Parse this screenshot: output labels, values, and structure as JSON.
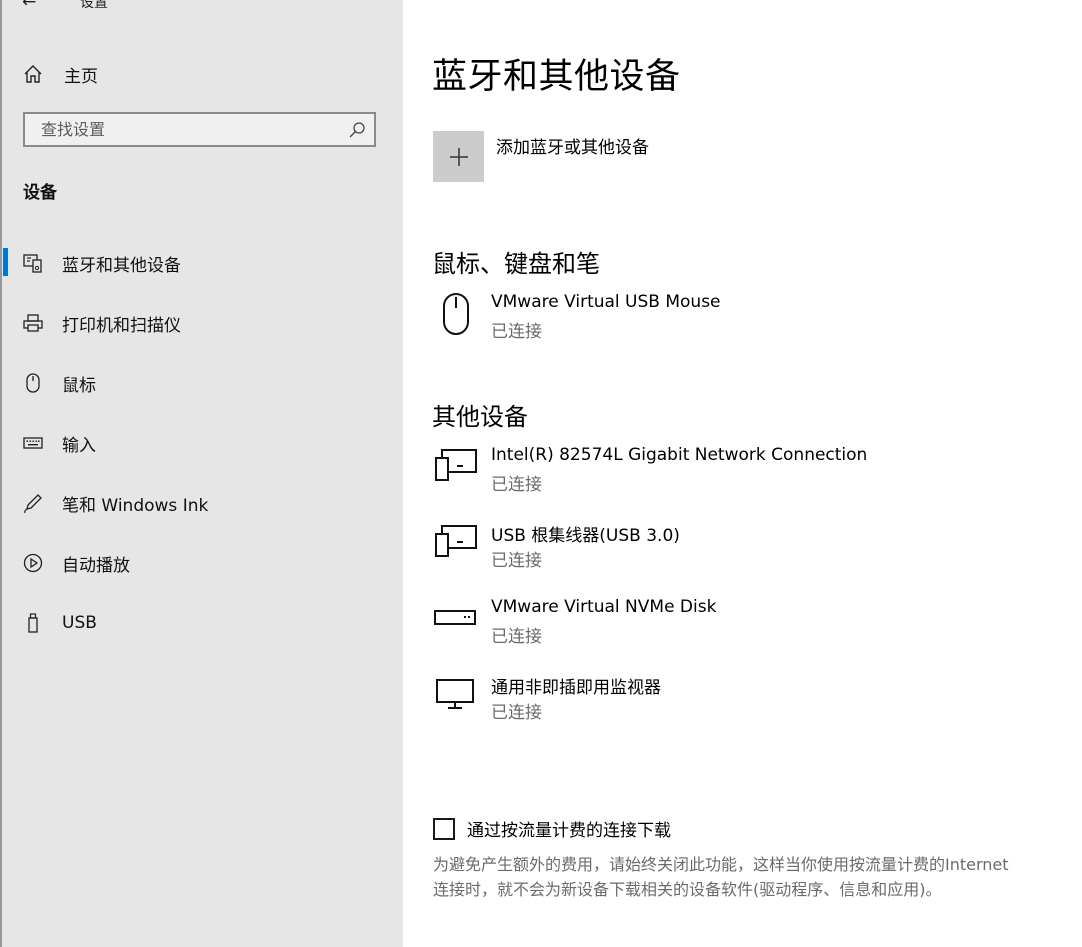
{
  "window": {
    "back_glyph": "←",
    "title": "设置"
  },
  "sidebar": {
    "home_label": "主页",
    "search_placeholder": "查找设置",
    "section_heading": "设备",
    "items": [
      {
        "label": "蓝牙和其他设备",
        "icon": "bluetooth-devices-icon",
        "selected": true
      },
      {
        "label": "打印机和扫描仪",
        "icon": "printer-icon",
        "selected": false
      },
      {
        "label": "鼠标",
        "icon": "mouse-icon",
        "selected": false
      },
      {
        "label": "输入",
        "icon": "keyboard-icon",
        "selected": false
      },
      {
        "label": "笔和 Windows Ink",
        "icon": "pen-icon",
        "selected": false
      },
      {
        "label": "自动播放",
        "icon": "autoplay-icon",
        "selected": false
      },
      {
        "label": "USB",
        "icon": "usb-icon",
        "selected": false
      }
    ],
    "accent_color": "#0078d7"
  },
  "main": {
    "title": "蓝牙和其他设备",
    "add_device_label": "添加蓝牙或其他设备",
    "groups": [
      {
        "title": "鼠标、键盘和笔",
        "devices": [
          {
            "name": "VMware Virtual USB Mouse",
            "status": "已连接",
            "icon": "mouse-icon"
          }
        ]
      },
      {
        "title": "其他设备",
        "devices": [
          {
            "name": "Intel(R) 82574L Gigabit Network Connection",
            "status": "已连接",
            "icon": "device-generic-icon"
          },
          {
            "name": "USB 根集线器(USB 3.0)",
            "status": "已连接",
            "icon": "device-generic-icon"
          },
          {
            "name": "VMware Virtual NVMe Disk",
            "status": "已连接",
            "icon": "drive-icon"
          },
          {
            "name": "通用非即插即用监视器",
            "status": "已连接",
            "icon": "monitor-icon"
          }
        ]
      }
    ],
    "metered": {
      "label": "通过按流量计费的连接下载",
      "checked": false,
      "description": "为避免产生额外的费用，请始终关闭此功能，这样当你使用按流量计费的Internet 连接时，就不会为新设备下载相关的设备软件(驱动程序、信息和应用)。"
    }
  }
}
